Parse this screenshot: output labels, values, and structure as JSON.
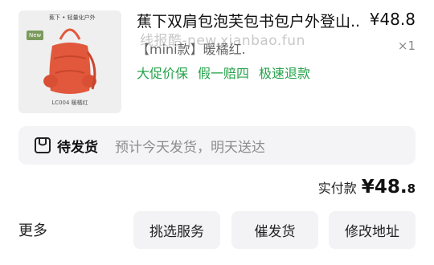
{
  "product": {
    "thumbnail": {
      "brand_text": "蕉下 • 轻量化户外",
      "new_badge": "New",
      "caption": "LC004 暖橘红",
      "bag_color": "#e2583c"
    },
    "title": "蕉下双肩包泡芙包书包户外登山...",
    "price": "¥48.8",
    "quantity": "×1",
    "variant": "【mini款】暖橘红.",
    "watermark": "线报酷-new.xianbao.fun",
    "tags": [
      "大促价保",
      "假一赔四",
      "极速退款"
    ],
    "tag_color": "#25a24a"
  },
  "shipping": {
    "icon": "package-icon",
    "status": "待发货",
    "note": "预计今天发货，明天送达"
  },
  "payment": {
    "label": "实付款",
    "currency": "¥",
    "amount_main": "48.",
    "amount_decimal": "8"
  },
  "actions": {
    "more": "更多",
    "buttons": [
      "挑选服务",
      "催发货",
      "修改地址"
    ]
  }
}
